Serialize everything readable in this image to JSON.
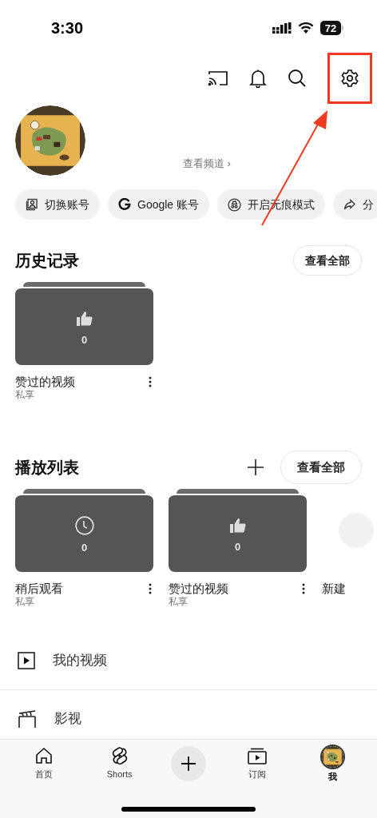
{
  "status_bar": {
    "time": "3:30",
    "battery": "72"
  },
  "channel_link": "查看频道 ›",
  "chips": [
    {
      "kind": "account",
      "label": "切换账号"
    },
    {
      "kind": "google",
      "label": "Google 账号"
    },
    {
      "kind": "incognito",
      "label": "开启无痕模式"
    },
    {
      "kind": "share",
      "label": "分"
    }
  ],
  "history": {
    "title": "历史记录",
    "view_all": "查看全部",
    "items": [
      {
        "kind": "like",
        "count": "0",
        "title": "赞过的视频",
        "privacy": "私享"
      }
    ]
  },
  "playlists": {
    "title": "播放列表",
    "view_all": "查看全部",
    "items": [
      {
        "kind": "clock",
        "count": "0",
        "title": "稍后观看",
        "privacy": "私享"
      },
      {
        "kind": "like",
        "count": "0",
        "title": "赞过的视频",
        "privacy": "私享"
      }
    ],
    "new_label": "新建"
  },
  "menu": [
    {
      "kind": "video",
      "label": "我的视频"
    },
    {
      "kind": "film",
      "label": "影视"
    }
  ],
  "nav": [
    {
      "kind": "home",
      "label": "首页",
      "selected": false
    },
    {
      "kind": "shorts",
      "label": "Shorts",
      "selected": false
    },
    {
      "kind": "create"
    },
    {
      "kind": "subs",
      "label": "订阅",
      "selected": false
    },
    {
      "kind": "me",
      "label": "我",
      "selected": true
    }
  ]
}
